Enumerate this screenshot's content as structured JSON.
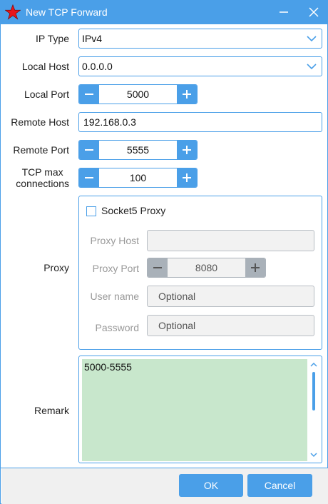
{
  "window": {
    "title": "New TCP Forward",
    "accent_color": "#4a9fe8",
    "app_icon": "red-star-icon"
  },
  "form": {
    "ip_type": {
      "label": "IP Type",
      "value": "IPv4"
    },
    "local_host": {
      "label": "Local Host",
      "value": "0.0.0.0"
    },
    "local_port": {
      "label": "Local Port",
      "value": "5000"
    },
    "remote_host": {
      "label": "Remote Host",
      "value": "192.168.0.3"
    },
    "remote_port": {
      "label": "Remote Port",
      "value": "5555"
    },
    "tcp_max": {
      "label_line1": "TCP max",
      "label_line2": "connections",
      "value": "100"
    }
  },
  "proxy": {
    "label": "Proxy",
    "checkbox_label": "Socket5 Proxy",
    "checked": false,
    "host": {
      "label": "Proxy Host",
      "value": ""
    },
    "port": {
      "label": "Proxy Port",
      "value": "8080"
    },
    "username": {
      "label": "User name",
      "placeholder": "Optional"
    },
    "password": {
      "label": "Password",
      "placeholder": "Optional"
    }
  },
  "remark": {
    "label": "Remark",
    "value": "5000-5555",
    "background": "#c8e7cc"
  },
  "footer": {
    "ok_label": "OK",
    "cancel_label": "Cancel"
  }
}
